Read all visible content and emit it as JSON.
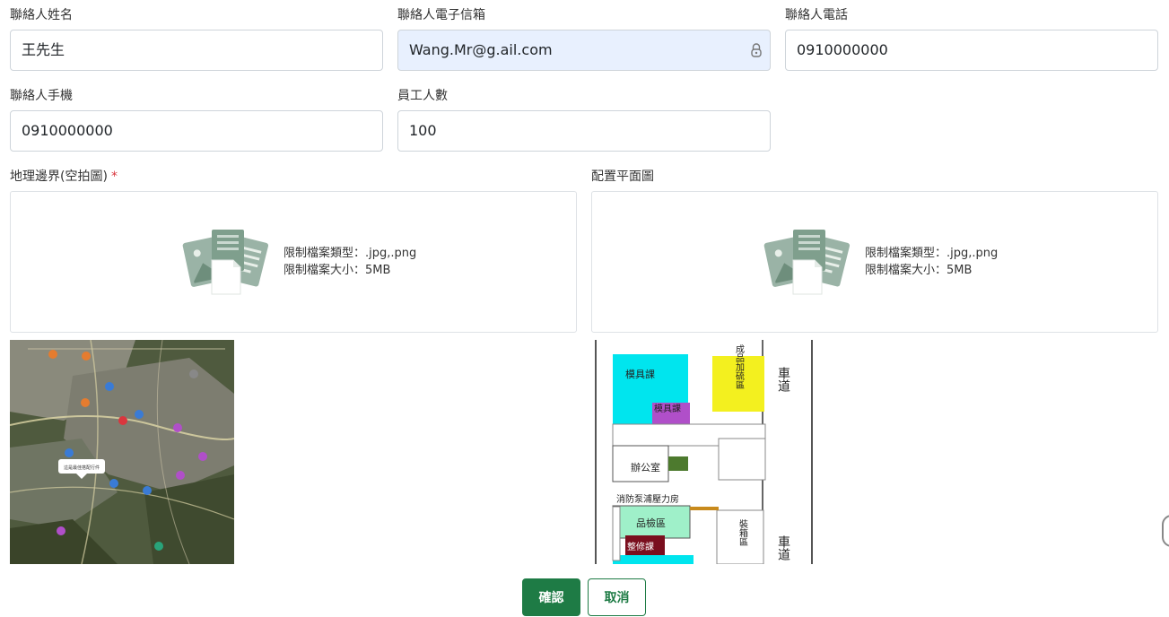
{
  "fields": {
    "contact_name": {
      "label": "聯絡人姓名",
      "value": "王先生"
    },
    "contact_email": {
      "label": "聯絡人電子信箱",
      "value": "Wang.Mr@g.ail.com"
    },
    "contact_phone": {
      "label": "聯絡人電話",
      "value": "0910000000"
    },
    "contact_mobile": {
      "label": "聯絡人手機",
      "value": "0910000000"
    },
    "employee_count": {
      "label": "員工人數",
      "value": "100"
    }
  },
  "uploads": {
    "boundary": {
      "label": "地理邊界(空拍圖)",
      "required_mark": "*",
      "type_hint": "限制檔案類型：.jpg,.png",
      "size_hint": "限制檔案大小：5MB",
      "map_tooltip": "這是最佳搭配行件"
    },
    "floorplan": {
      "label": "配置平面圖",
      "type_hint": "限制檔案類型：.jpg,.png",
      "size_hint": "限制檔案大小：5MB",
      "rooms": {
        "mold1": "模具課",
        "mold2": "模具課",
        "finished": "成品加硫區",
        "office": "辦公室",
        "fire_pump": "消防泵浦壓力房",
        "inspection": "品檢區",
        "repair": "整修課",
        "packing": "裝箱區",
        "lane_top": "車道",
        "lane_bottom": "車道"
      }
    }
  },
  "actions": {
    "confirm": "確認",
    "cancel": "取消"
  },
  "colors": {
    "primary": "#1e7b45",
    "autofill_bg": "#e8f0fe",
    "required": "#d9363e"
  }
}
